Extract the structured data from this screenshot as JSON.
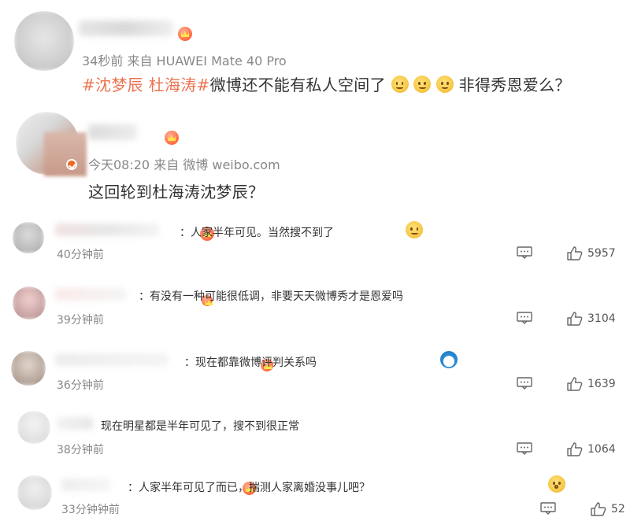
{
  "post1": {
    "meta": "34秒前  来自 HUAWEI Mate 40 Pro",
    "hashtags": [
      "#沈梦辰",
      "杜海涛#"
    ],
    "text": "微博还不能有私人空间了",
    "text2": "非得秀恩爱么？"
  },
  "post2": {
    "meta": "今天08:20  来自 微博 weibo.com",
    "text": "这回轮到杜海涛沈梦辰？"
  },
  "comments": [
    {
      "text": "：人家半年可见。当然搜不到了",
      "time": "40分钟前",
      "likes": "5957"
    },
    {
      "text": "：有没有一种可能很低调，非要天天微博秀才是恩爱吗",
      "time": "39分钟前",
      "likes": "3104"
    },
    {
      "text": "：现在都靠微博评判关系吗",
      "time": "36分钟前",
      "likes": "1639"
    },
    {
      "text": "现在明星都是半年可见了，搜不到很正常",
      "time": "38分钟前",
      "likes": "1064"
    },
    {
      "text": "：人家半年可见了而已，揣测人家离婚没事儿吧？",
      "time": "33分钟钟前",
      "likes": "52"
    }
  ],
  "icons": {
    "comment": "comment-icon",
    "like": "thumbs-up-icon",
    "badge": "crown-badge-icon",
    "emoji": "smiley-emoji"
  },
  "colors": {
    "hashtag": "#eb7350",
    "meta": "#888888",
    "text": "#333333"
  }
}
